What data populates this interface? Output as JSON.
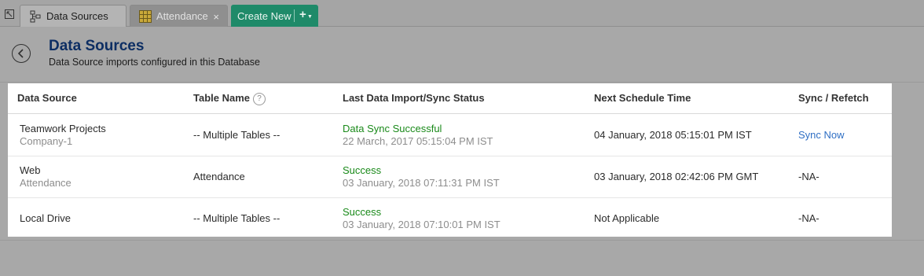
{
  "tabs": {
    "data_sources_label": "Data Sources",
    "attendance_label": "Attendance",
    "attendance_close": "×",
    "create_new_label": "Create New",
    "create_new_plus": "+"
  },
  "header": {
    "title": "Data Sources",
    "subtitle": "Data Source imports configured in this Database"
  },
  "table": {
    "columns": [
      "Data Source",
      "Table Name",
      "Last Data Import/Sync Status",
      "Next Schedule Time",
      "Sync / Refetch"
    ],
    "help_glyph": "?",
    "rows": [
      {
        "source": "Teamwork Projects",
        "source_sub": "Company-1",
        "table": "-- Multiple Tables --",
        "status": "Data Sync Successful",
        "status_time": "22 March, 2017 05:15:04 PM IST",
        "next": "04 January, 2018 05:15:01 PM IST",
        "sync": "Sync Now"
      },
      {
        "source": "Web",
        "source_sub": "Attendance",
        "table": "Attendance",
        "status": "Success",
        "status_time": "03 January, 2018 07:11:31 PM IST",
        "next": "03 January, 2018 02:42:06 PM GMT",
        "sync": "-NA-"
      },
      {
        "source": "Local Drive",
        "source_sub": "",
        "table": "-- Multiple Tables --",
        "status": "Success",
        "status_time": "03 January, 2018 07:10:01 PM IST",
        "next": "Not Applicable",
        "sync": "-NA-"
      }
    ]
  },
  "icons": {
    "corner": "expand-icon",
    "data_sources_tab": "data-sources-icon",
    "attendance_tab": "table-grid-icon",
    "back": "back-arrow-icon"
  },
  "colors": {
    "title": "#0d2e63",
    "success": "#1a8a1a",
    "link": "#2f6fc4",
    "create_new": "#1f8a69"
  }
}
